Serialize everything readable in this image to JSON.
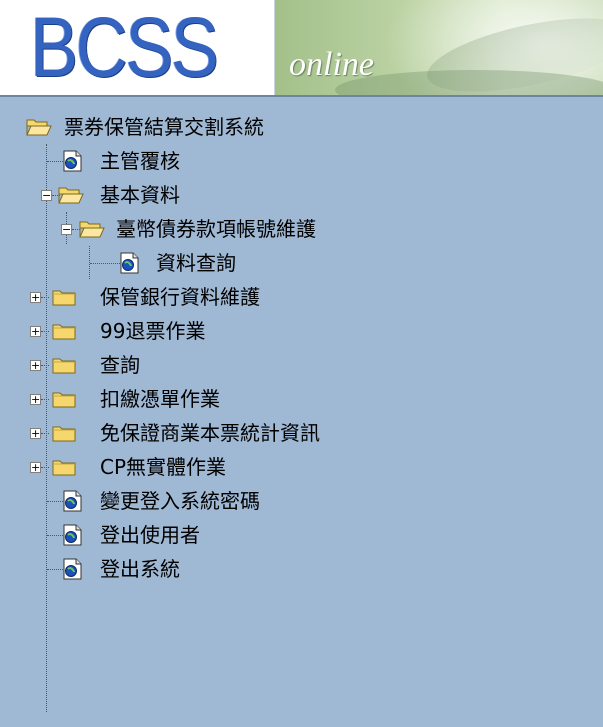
{
  "header": {
    "logo_text": "BCSS",
    "tagline": "online"
  },
  "tree": {
    "root": {
      "label": "票券保管結算交割系統",
      "icon": "open-folder-icon"
    },
    "items": [
      {
        "label": "主管覆核",
        "icon": "document-icon"
      },
      {
        "label": "基本資料",
        "icon": "open-folder-icon",
        "expander": "−"
      },
      {
        "label": "臺幣債券款項帳號維護",
        "icon": "open-folder-icon",
        "expander": "−"
      },
      {
        "label": "資料查詢",
        "icon": "document-icon"
      },
      {
        "label": "保管銀行資料維護",
        "icon": "folder-icon",
        "expander": "+"
      },
      {
        "label": "99退票作業",
        "icon": "folder-icon",
        "expander": "+"
      },
      {
        "label": "查詢",
        "icon": "folder-icon",
        "expander": "+"
      },
      {
        "label": "扣繳憑單作業",
        "icon": "folder-icon",
        "expander": "+"
      },
      {
        "label": "免保證商業本票統計資訊",
        "icon": "folder-icon",
        "expander": "+"
      },
      {
        "label": "CP無實體作業",
        "icon": "folder-icon",
        "expander": "+"
      },
      {
        "label": "變更登入系統密碼",
        "icon": "document-icon"
      },
      {
        "label": "登出使用者",
        "icon": "document-icon"
      },
      {
        "label": "登出系統",
        "icon": "document-icon"
      }
    ]
  }
}
